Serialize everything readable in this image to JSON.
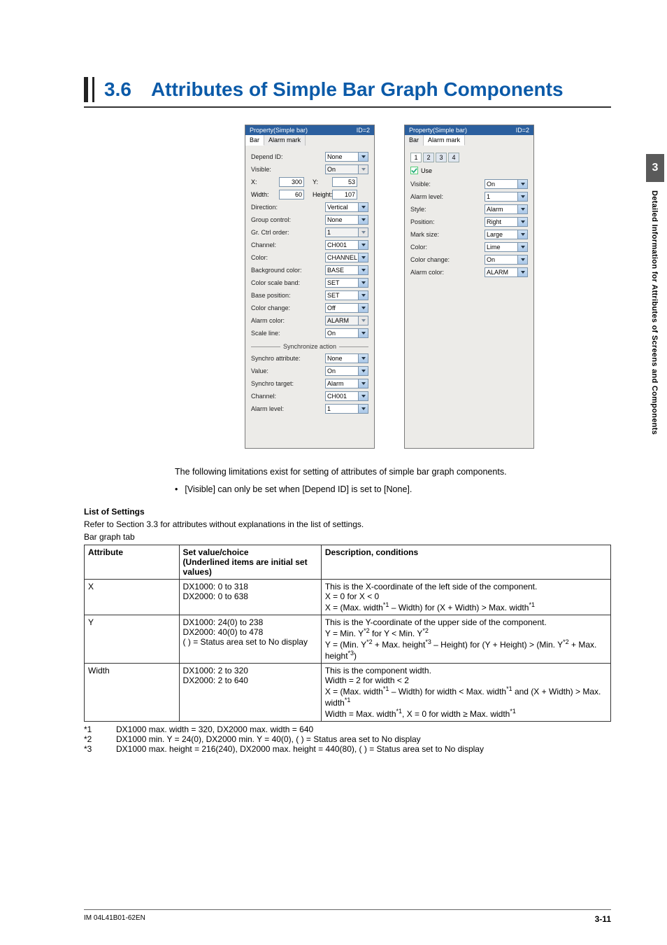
{
  "sideTab": {
    "num": "3",
    "text": "Detailed Information for Attributes of Screens and Components"
  },
  "title": {
    "num": "3.6",
    "text": "Attributes of Simple Bar Graph Components"
  },
  "panelHeader": {
    "left": "Property(Simple bar)",
    "right": "ID=2"
  },
  "barTab": {
    "tabs": [
      "Bar",
      "Alarm mark"
    ],
    "activeIndex": 0
  },
  "bar": {
    "dependId": {
      "label": "Depend ID:",
      "value": "None"
    },
    "visible": {
      "label": "Visible:",
      "value": "On"
    },
    "x": {
      "label": "X:",
      "value": "300"
    },
    "y": {
      "label": "Y:",
      "value": "53"
    },
    "width": {
      "label": "Width:",
      "value": "60"
    },
    "height": {
      "label": "Height:",
      "value": "107"
    },
    "direction": {
      "label": "Direction:",
      "value": "Vertical"
    },
    "groupControl": {
      "label": "Group control:",
      "value": "None"
    },
    "grCtrlOrder": {
      "label": "Gr. Ctrl order:",
      "value": "1"
    },
    "channel": {
      "label": "Channel:",
      "value": "CH001"
    },
    "color": {
      "label": "Color:",
      "value": "CHANNEL"
    },
    "backgroundColor": {
      "label": "Background color:",
      "value": "BASE"
    },
    "colorScaleBand": {
      "label": "Color scale band:",
      "value": "SET"
    },
    "basePosition": {
      "label": "Base position:",
      "value": "SET"
    },
    "colorChange": {
      "label": "Color change:",
      "value": "Off"
    },
    "alarmColor": {
      "label": "Alarm color:",
      "value": "ALARM"
    },
    "scaleLine": {
      "label": "Scale line:",
      "value": "On"
    },
    "syncHeader": "Synchronize action",
    "syncAttr": {
      "label": "Synchro attribute:",
      "value": "None"
    },
    "syncValue": {
      "label": "Value:",
      "value": "On"
    },
    "syncTarget": {
      "label": "Synchro target:",
      "value": "Alarm"
    },
    "syncChannel": {
      "label": "Channel:",
      "value": "CH001"
    },
    "syncAlarmLevel": {
      "label": "Alarm level:",
      "value": "1"
    }
  },
  "alarmTab": {
    "tabs": [
      "Bar",
      "Alarm mark"
    ],
    "activeIndex": 1
  },
  "alarm": {
    "numTabs": [
      "1",
      "2",
      "3",
      "4"
    ],
    "useLabel": "Use",
    "visible": {
      "label": "Visible:",
      "value": "On"
    },
    "alarmLevel": {
      "label": "Alarm level:",
      "value": "1"
    },
    "style": {
      "label": "Style:",
      "value": "Alarm"
    },
    "position": {
      "label": "Position:",
      "value": "Right"
    },
    "markSize": {
      "label": "Mark size:",
      "value": "Large"
    },
    "color": {
      "label": "Color:",
      "value": "Lime"
    },
    "colorChange": {
      "label": "Color change:",
      "value": "On"
    },
    "alarmColor": {
      "label": "Alarm color:",
      "value": "ALARM"
    }
  },
  "para": "The following limitations exist for setting of attributes of simple bar graph components.",
  "bullet": "[Visible] can only be set when [Depend ID] is set to [None].",
  "listHeading": "List of Settings",
  "listPara": "Refer to Section 3.3 for attributes without explanations in the list of settings.",
  "tabCaption": "Bar graph tab",
  "tableHead": {
    "c1": "Attribute",
    "c2": "Set value/choice",
    "c2b": "(Underlined items are initial set values)",
    "c3": "Description, conditions"
  },
  "rows": [
    {
      "attr": "X",
      "set": [
        "DX1000: 0 to 318",
        "DX2000: 0 to 638"
      ],
      "desc": [
        "This is the X-coordinate of the left side of the component.",
        "X = 0 for X < 0",
        "X = (Max. width*1 – Width) for (X + Width) > Max. width*1"
      ]
    },
    {
      "attr": "Y",
      "set": [
        "DX1000: 24(0) to 238",
        "DX2000: 40(0) to 478",
        "(   ) = Status area set to No display"
      ],
      "desc": [
        "This is the Y-coordinate of the upper side of the component.",
        "Y = Min. Y*2 for Y < Min. Y*2",
        "Y = (Min. Y*2 + Max. height*3 – Height) for (Y + Height) > (Min. Y*2 + Max. height*3)"
      ]
    },
    {
      "attr": "Width",
      "set": [
        "DX1000: 2 to 320",
        "DX2000: 2 to 640"
      ],
      "desc": [
        "This is the component width.",
        "Width = 2 for width < 2",
        "X = (Max. width*1 – Width) for width < Max. width*1 and (X + Width) > Max. width*1",
        "Width = Max. width*1, X = 0 for width ≥ Max. width*1"
      ]
    }
  ],
  "footnotes": [
    {
      "k": "*1",
      "v": "DX1000 max. width = 320, DX2000 max. width = 640"
    },
    {
      "k": "*2",
      "v": "DX1000 min. Y = 24(0), DX2000 min. Y = 40(0), (   ) = Status area set to No display"
    },
    {
      "k": "*3",
      "v": "DX1000 max. height = 216(240), DX2000 max. height = 440(80), (   ) = Status area set to No display"
    }
  ],
  "footer": {
    "left": "IM 04L41B01-62EN",
    "right": "3-11"
  }
}
